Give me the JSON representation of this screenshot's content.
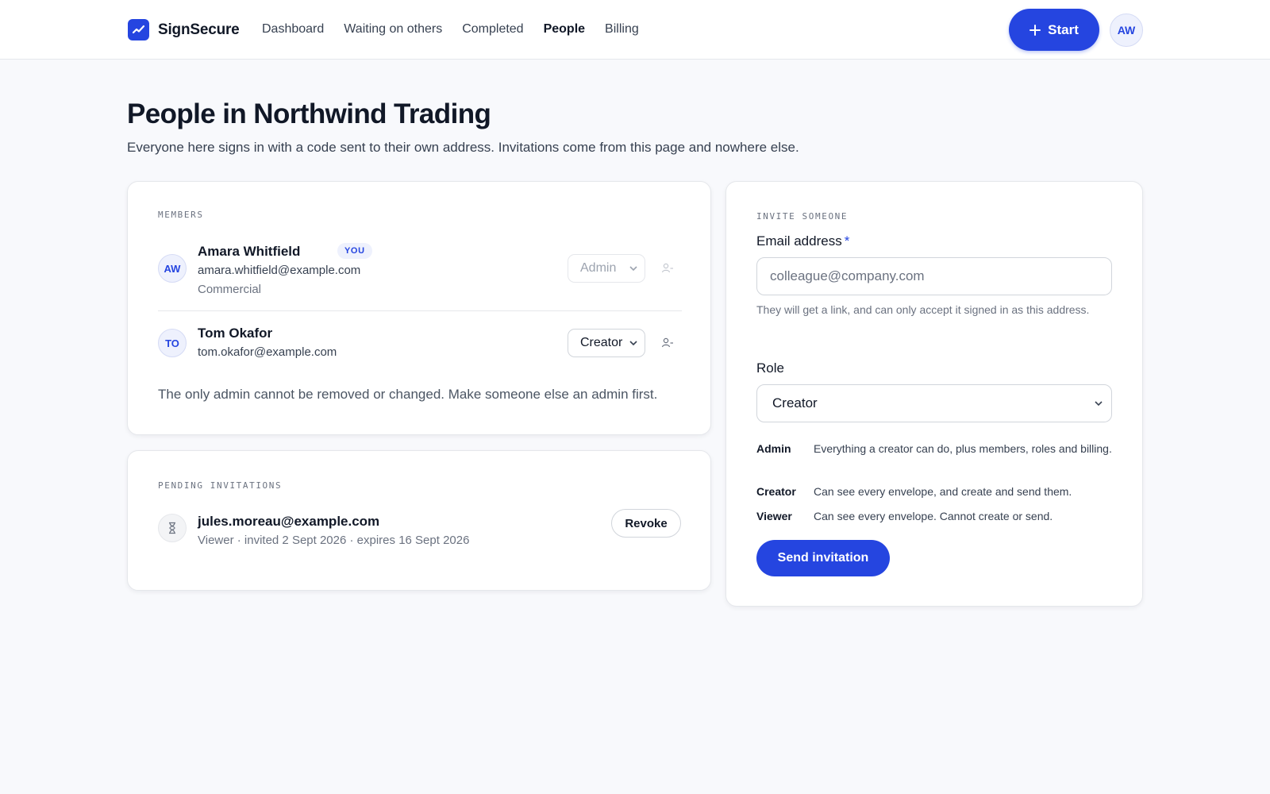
{
  "app": {
    "name": "SignSecure",
    "accent": "#2545e0"
  },
  "nav": {
    "items": [
      {
        "label": "Dashboard"
      },
      {
        "label": "Waiting on others"
      },
      {
        "label": "Completed"
      },
      {
        "label": "People"
      },
      {
        "label": "Billing"
      }
    ],
    "active": "People"
  },
  "header": {
    "start_label": "Start",
    "avatar_initials": "AW"
  },
  "page": {
    "title": "People in Northwind Trading",
    "subtitle": "Everyone here signs in with a code sent to their own address. Invitations come from this page and nowhere else."
  },
  "members": {
    "eyebrow": "MEMBERS",
    "list": [
      {
        "initials": "AW",
        "name": "Amara Whitfield",
        "badge": "YOU",
        "email": "amara.whitfield@example.com",
        "team": "Commercial",
        "role": "Admin",
        "role_disabled": true
      },
      {
        "initials": "TO",
        "name": "Tom Okafor",
        "email": "tom.okafor@example.com",
        "role": "Creator",
        "role_disabled": false
      }
    ],
    "note": "The only admin cannot be removed or changed. Make someone else an admin first."
  },
  "pending": {
    "eyebrow": "PENDING INVITATIONS",
    "list": [
      {
        "email": "jules.moreau@example.com",
        "meta": "Viewer · invited 2 Sept 2026 · expires 16 Sept 2026",
        "action": "Revoke"
      }
    ]
  },
  "invite": {
    "eyebrow": "INVITE SOMEONE",
    "email_label": "Email address",
    "required_mark": "*",
    "email_placeholder": "colleague@company.com",
    "email_value": "",
    "hint": "They will get a link, and can only accept it signed in as this address.",
    "role_label": "Role",
    "role_value": "Creator",
    "roles": [
      {
        "name": "Admin",
        "desc": "Everything a creator can do, plus members, roles and billing."
      },
      {
        "name": "Creator",
        "desc": "Can see every envelope, and create and send them."
      },
      {
        "name": "Viewer",
        "desc": "Can see every envelope. Cannot create or send."
      }
    ],
    "submit_label": "Send invitation"
  }
}
